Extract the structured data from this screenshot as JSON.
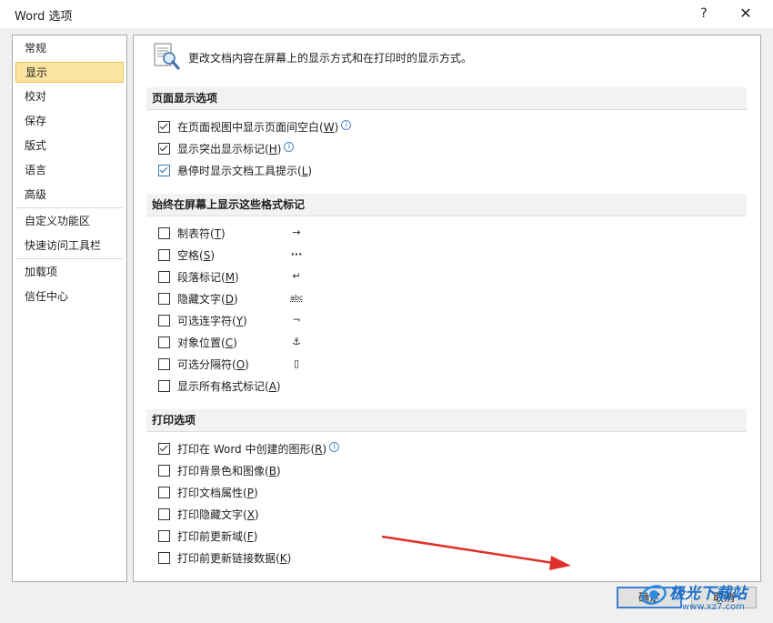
{
  "window": {
    "title": "Word 选项",
    "help_glyph": "?",
    "close_glyph": "✕"
  },
  "sidebar": {
    "items": [
      {
        "label": "常规"
      },
      {
        "label": "显示",
        "selected": true
      },
      {
        "label": "校对"
      },
      {
        "label": "保存"
      },
      {
        "label": "版式"
      },
      {
        "label": "语言"
      },
      {
        "label": "高级"
      },
      {
        "label": "自定义功能区"
      },
      {
        "label": "快速访问工具栏"
      },
      {
        "label": "加载项"
      },
      {
        "label": "信任中心"
      }
    ]
  },
  "banner": {
    "text": "更改文档内容在屏幕上的显示方式和在打印时的显示方式。",
    "icon": "document-magnifier-icon"
  },
  "page_display": {
    "heading": "页面显示选项",
    "options": [
      {
        "text": "在页面视图中显示页面间空白(",
        "key": "W",
        "end": ")",
        "checked": true,
        "info": true
      },
      {
        "text": "显示突出显示标记(",
        "key": "H",
        "end": ")",
        "checked": true,
        "info": true
      },
      {
        "text": "悬停时显示文档工具提示(",
        "key": "L",
        "end": ")",
        "checked": true,
        "info": false
      }
    ]
  },
  "format_marks": {
    "heading": "始终在屏幕上显示这些格式标记",
    "options": [
      {
        "text": "制表符(",
        "key": "T",
        "end": ")",
        "checked": false,
        "symbol": "→",
        "symbol_icon": "tab-arrow-icon"
      },
      {
        "text": "空格(",
        "key": "S",
        "end": ")",
        "checked": false,
        "symbol": "···",
        "symbol_icon": "space-dots-icon"
      },
      {
        "text": "段落标记(",
        "key": "M",
        "end": ")",
        "checked": false,
        "symbol": "↵",
        "symbol_icon": "paragraph-mark-icon"
      },
      {
        "text": "隐藏文字(",
        "key": "D",
        "end": ")",
        "checked": false,
        "symbol": "abc",
        "symbol_icon": "hidden-text-icon"
      },
      {
        "text": "可选连字符(",
        "key": "Y",
        "end": ")",
        "checked": false,
        "symbol": "¬",
        "symbol_icon": "optional-hyphen-icon"
      },
      {
        "text": "对象位置(",
        "key": "C",
        "end": ")",
        "checked": false,
        "symbol": "⚓",
        "symbol_icon": "anchor-icon"
      },
      {
        "text": "可选分隔符(",
        "key": "O",
        "end": ")",
        "checked": false,
        "symbol": "▯",
        "symbol_icon": "optional-break-icon"
      },
      {
        "text": "显示所有格式标记(",
        "key": "A",
        "end": ")",
        "checked": false
      }
    ]
  },
  "print": {
    "heading": "打印选项",
    "options": [
      {
        "text": "打印在 Word 中创建的图形(",
        "key": "R",
        "end": ")",
        "checked": true,
        "info": true
      },
      {
        "text": "打印背景色和图像(",
        "key": "B",
        "end": ")",
        "checked": false
      },
      {
        "text": "打印文档属性(",
        "key": "P",
        "end": ")",
        "checked": false
      },
      {
        "text": "打印隐藏文字(",
        "key": "X",
        "end": ")",
        "checked": false
      },
      {
        "text": "打印前更新域(",
        "key": "F",
        "end": ")",
        "checked": false
      },
      {
        "text": "打印前更新链接数据(",
        "key": "K",
        "end": ")",
        "checked": false
      }
    ]
  },
  "buttons": {
    "ok": "确定",
    "cancel": "取消"
  },
  "watermark": {
    "brand": "极光下载站",
    "url": "www.xz7.com"
  },
  "colors": {
    "selected_bg": "#fbe3a0",
    "section_bg": "#f2f2f2",
    "annotation_arrow": "#e0302a",
    "default_button_border": "#3c7fd1"
  }
}
